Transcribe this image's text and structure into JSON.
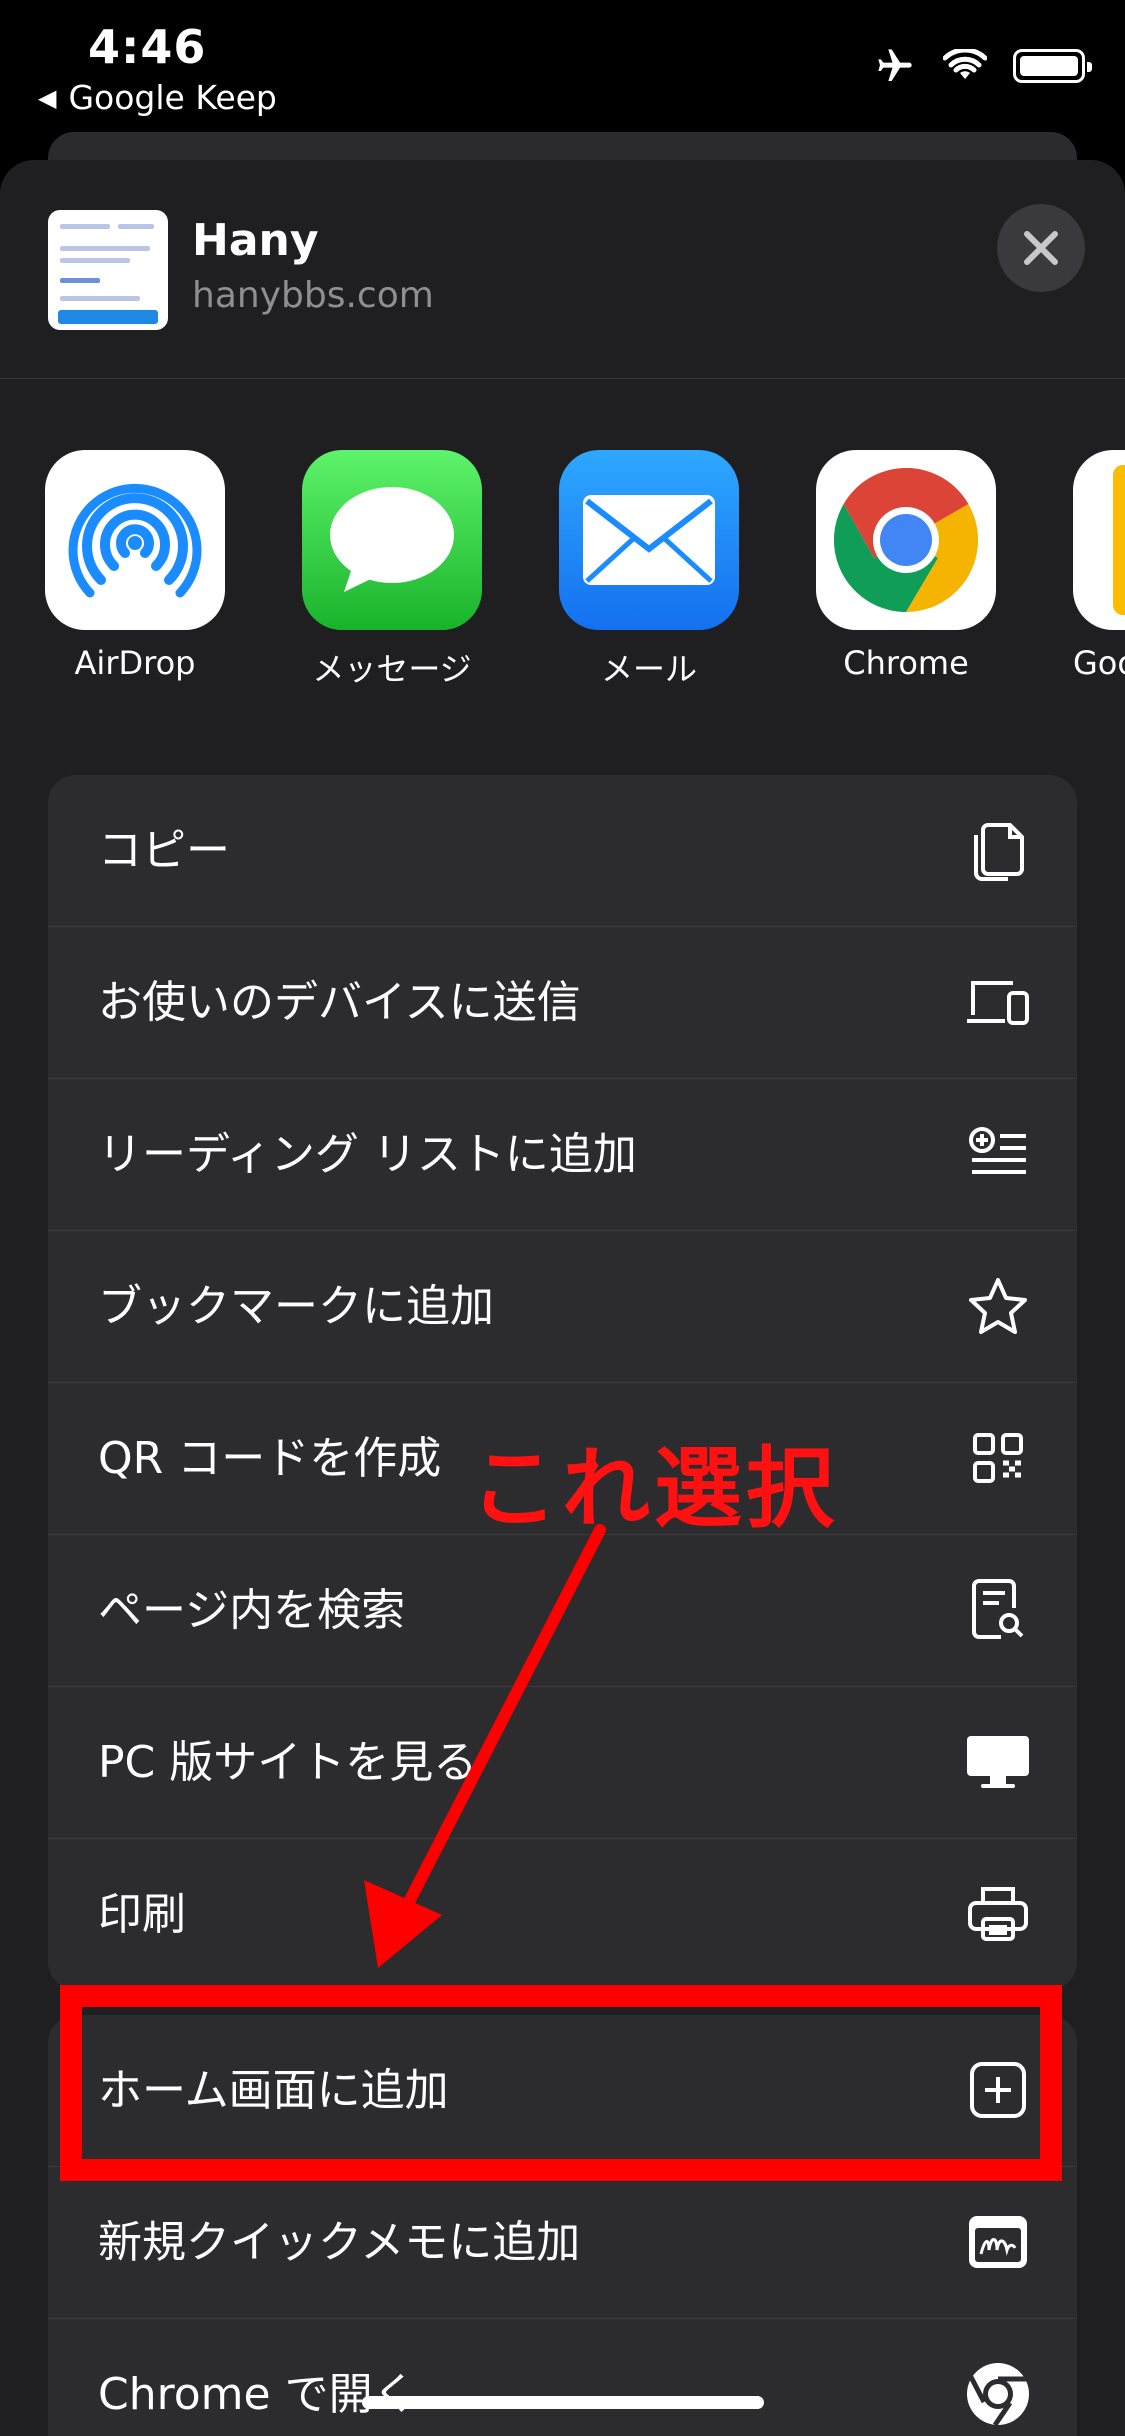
{
  "status": {
    "time": "4:46",
    "back_app": "Google Keep"
  },
  "header": {
    "title": "Hany",
    "url": "hanybbs.com"
  },
  "apps": [
    {
      "name": "AirDrop"
    },
    {
      "name": "メッセージ"
    },
    {
      "name": "メール"
    },
    {
      "name": "Chrome"
    },
    {
      "name": "Goo"
    }
  ],
  "actions": [
    {
      "label": "コピー",
      "icon": "copy-icon"
    },
    {
      "label": "お使いのデバイスに送信",
      "icon": "devices-icon"
    },
    {
      "label": "リーディング リストに追加",
      "icon": "reading-list-icon"
    },
    {
      "label": "ブックマークに追加",
      "icon": "star-icon"
    },
    {
      "label": "QR コードを作成",
      "icon": "qr-code-icon"
    },
    {
      "label": "ページ内を検索",
      "icon": "find-in-page-icon"
    },
    {
      "label": "PC 版サイトを見る",
      "icon": "desktop-icon"
    },
    {
      "label": "印刷",
      "icon": "printer-icon"
    }
  ],
  "actions2": [
    {
      "label": "ホーム画面に追加",
      "icon": "plus-square-icon"
    },
    {
      "label": "新規クイックメモに追加",
      "icon": "quick-note-icon"
    },
    {
      "label": "Chrome で開く",
      "icon": "chrome-icon"
    }
  ],
  "annotation": {
    "text": "これ選択",
    "color": "#ff0000"
  }
}
